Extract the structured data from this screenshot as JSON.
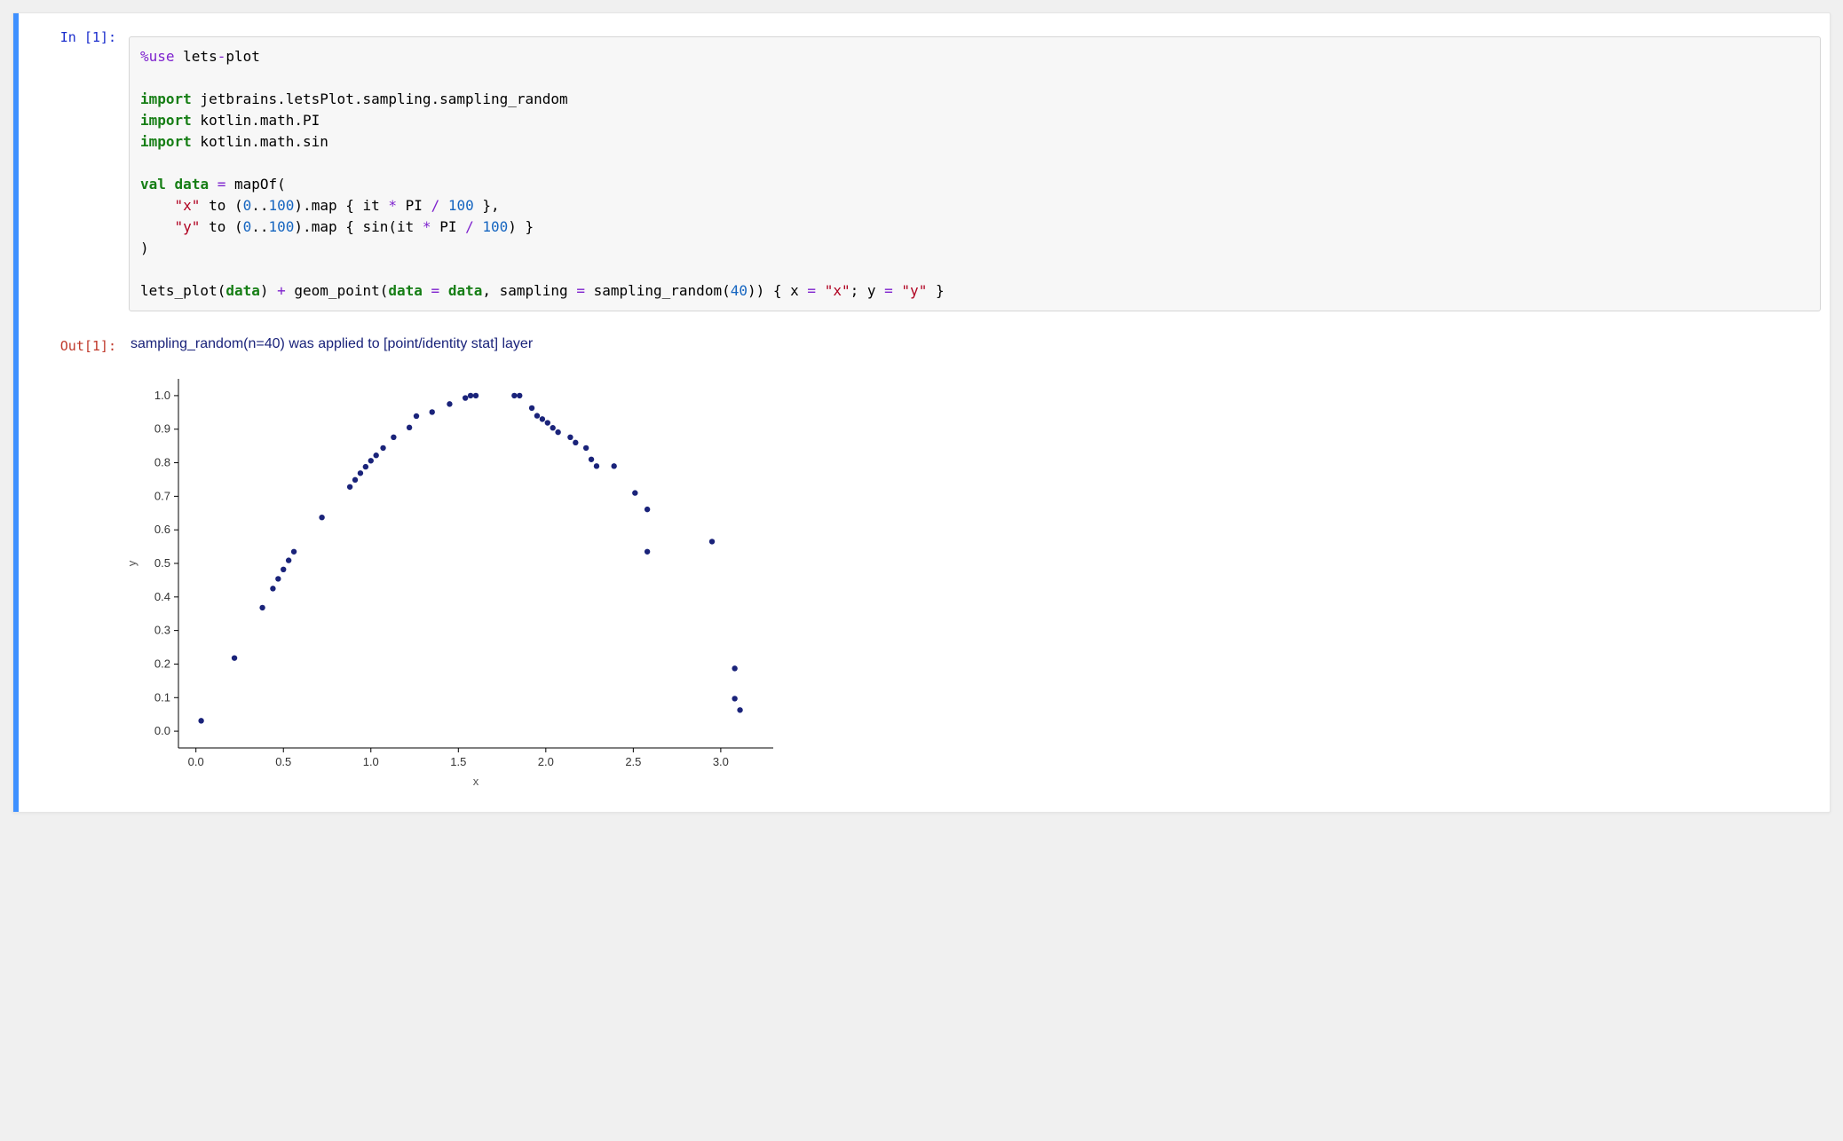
{
  "cell": {
    "in_prompt": "In [1]:",
    "out_prompt": "Out[1]:",
    "code_tokens": [
      {
        "t": "%use",
        "c": "hl-magic"
      },
      {
        "t": " lets"
      },
      {
        "t": "-",
        "c": "hl-op"
      },
      {
        "t": "plot\n\n"
      },
      {
        "t": "import",
        "c": "hl-keyword"
      },
      {
        "t": " jetbrains.letsPlot.sampling.sampling_random\n"
      },
      {
        "t": "import",
        "c": "hl-keyword"
      },
      {
        "t": " kotlin.math.PI\n"
      },
      {
        "t": "import",
        "c": "hl-keyword"
      },
      {
        "t": " kotlin.math.sin\n\n"
      },
      {
        "t": "val",
        "c": "hl-keyword"
      },
      {
        "t": " "
      },
      {
        "t": "data",
        "c": "hl-keyword"
      },
      {
        "t": " "
      },
      {
        "t": "=",
        "c": "hl-op"
      },
      {
        "t": " mapOf(\n"
      },
      {
        "t": "    "
      },
      {
        "t": "\"x\"",
        "c": "hl-string"
      },
      {
        "t": " to ("
      },
      {
        "t": "0",
        "c": "hl-num"
      },
      {
        "t": ".."
      },
      {
        "t": "100",
        "c": "hl-num"
      },
      {
        "t": ").map { it "
      },
      {
        "t": "*",
        "c": "hl-op"
      },
      {
        "t": " PI "
      },
      {
        "t": "/",
        "c": "hl-op"
      },
      {
        "t": " "
      },
      {
        "t": "100",
        "c": "hl-num"
      },
      {
        "t": " },\n"
      },
      {
        "t": "    "
      },
      {
        "t": "\"y\"",
        "c": "hl-string"
      },
      {
        "t": " to ("
      },
      {
        "t": "0",
        "c": "hl-num"
      },
      {
        "t": ".."
      },
      {
        "t": "100",
        "c": "hl-num"
      },
      {
        "t": ").map { sin(it "
      },
      {
        "t": "*",
        "c": "hl-op"
      },
      {
        "t": " PI "
      },
      {
        "t": "/",
        "c": "hl-op"
      },
      {
        "t": " "
      },
      {
        "t": "100",
        "c": "hl-num"
      },
      {
        "t": ") }\n"
      },
      {
        "t": ")\n\n"
      },
      {
        "t": "lets_plot("
      },
      {
        "t": "data",
        "c": "hl-keyword"
      },
      {
        "t": ") "
      },
      {
        "t": "+",
        "c": "hl-op"
      },
      {
        "t": " geom_point("
      },
      {
        "t": "data",
        "c": "hl-keyword"
      },
      {
        "t": " "
      },
      {
        "t": "=",
        "c": "hl-op"
      },
      {
        "t": " "
      },
      {
        "t": "data",
        "c": "hl-keyword"
      },
      {
        "t": ", sampling "
      },
      {
        "t": "=",
        "c": "hl-op"
      },
      {
        "t": " sampling_random("
      },
      {
        "t": "40",
        "c": "hl-num"
      },
      {
        "t": ")) { x "
      },
      {
        "t": "=",
        "c": "hl-op"
      },
      {
        "t": " "
      },
      {
        "t": "\"x\"",
        "c": "hl-string"
      },
      {
        "t": "; y "
      },
      {
        "t": "=",
        "c": "hl-op"
      },
      {
        "t": " "
      },
      {
        "t": "\"y\"",
        "c": "hl-string"
      },
      {
        "t": " }"
      }
    ],
    "out_text": "sampling_random(n=40) was applied to [point/identity stat] layer"
  },
  "chart_data": {
    "type": "scatter",
    "title": "",
    "xlabel": "x",
    "ylabel": "y",
    "xlim": [
      -0.1,
      3.3
    ],
    "ylim": [
      -0.05,
      1.05
    ],
    "xticks": [
      0.0,
      0.5,
      1.0,
      1.5,
      2.0,
      2.5,
      3.0
    ],
    "yticks": [
      0.0,
      0.1,
      0.2,
      0.3,
      0.4,
      0.5,
      0.6,
      0.7,
      0.8,
      0.9,
      1.0
    ],
    "x": [
      0.03,
      0.22,
      0.38,
      0.44,
      0.47,
      0.5,
      0.53,
      0.56,
      0.72,
      0.88,
      0.91,
      0.94,
      0.97,
      1.0,
      1.03,
      1.07,
      1.13,
      1.22,
      1.26,
      1.35,
      1.45,
      1.54,
      1.57,
      1.6,
      1.82,
      1.85,
      1.92,
      1.95,
      1.98,
      2.01,
      2.04,
      2.07,
      2.14,
      2.17,
      2.23,
      2.26,
      2.29,
      2.39,
      2.51,
      2.58,
      2.58,
      2.95,
      3.08,
      3.08,
      3.11
    ],
    "y": [
      0.031,
      0.218,
      0.368,
      0.425,
      0.454,
      0.482,
      0.509,
      0.535,
      0.637,
      0.728,
      0.749,
      0.769,
      0.788,
      0.806,
      0.822,
      0.844,
      0.876,
      0.905,
      0.939,
      0.951,
      0.975,
      0.993,
      1.0,
      1.0,
      1.0,
      1.0,
      0.963,
      0.94,
      0.93,
      0.919,
      0.904,
      0.891,
      0.876,
      0.86,
      0.844,
      0.81,
      0.79,
      0.79,
      0.71,
      0.661,
      0.535,
      0.565,
      0.187,
      0.097,
      0.063,
      0.031
    ],
    "point_color": "#1a237a"
  }
}
